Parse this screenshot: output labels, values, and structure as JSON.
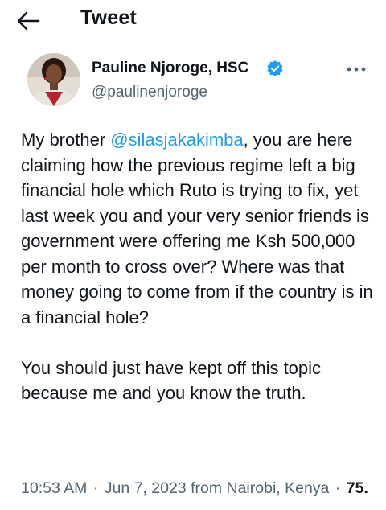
{
  "header": {
    "title": "Tweet"
  },
  "author": {
    "name": "Pauline Njoroge, HSC",
    "handle": "@paulinenjoroge",
    "verified_color": "#1d9bf0"
  },
  "tweet": {
    "para1_before": "My brother ",
    "mention": "@silasjakakimba",
    "para1_after": ", you are here claiming how the previous regime left a big financial hole which Ruto is trying to fix, yet last week you and your very senior friends is government were offering me Ksh 500,000 per month to cross over? Where was that money going to come from if the country is in a financial hole?",
    "para2": "You should just have kept off this topic because me and you know the truth."
  },
  "meta": {
    "time": "10:53 AM",
    "date": "Jun 7, 2023",
    "location": "from Nairobi, Kenya",
    "separator": "·",
    "views": "75."
  },
  "colors": {
    "accent": "#1d9bf0",
    "text": "#0f1419",
    "secondary": "#536471"
  },
  "icons": {
    "back": "arrow-left-icon",
    "verified": "verified-badge-icon",
    "more": "more-horizontal-icon"
  }
}
